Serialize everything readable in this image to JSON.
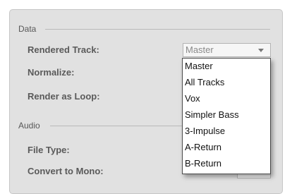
{
  "data_section": {
    "heading": "Data",
    "rendered_track_label": "Rendered Track:",
    "rendered_track_value": "Master",
    "normalize_label": "Normalize:",
    "render_as_loop_label": "Render as Loop:"
  },
  "audio_section": {
    "heading": "Audio",
    "file_type_label": "File Type:",
    "convert_to_mono_label": "Convert to Mono:"
  },
  "dropdown": {
    "options": [
      "Master",
      "All Tracks",
      "Vox",
      "Simpler Bass",
      "3-Impulse",
      "A-Return",
      "B-Return"
    ]
  }
}
